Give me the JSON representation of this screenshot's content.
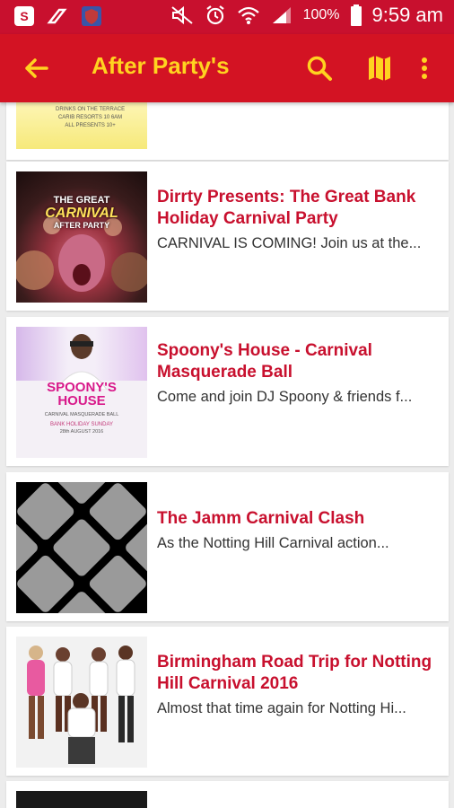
{
  "status_bar": {
    "battery": "100%",
    "time": "9:59 am"
  },
  "app_bar": {
    "title": "After Party's"
  },
  "cards": [
    {
      "title": "Dirrty Presents: The Great Bank Holiday Carnival Party",
      "description": "CARNIVAL IS COMING! Join us at the..."
    },
    {
      "title": "Spoony's House - Carnival Masquerade Ball",
      "description": "Come and join DJ Spoony & friends f..."
    },
    {
      "title": "The Jamm Carnival Clash",
      "description": "As the Notting Hill Carnival action..."
    },
    {
      "title": "Birmingham Road Trip for Notting Hill Carnival 2016",
      "description": "Almost that time again for Notting Hi..."
    }
  ],
  "thumb_texts": {
    "partial_top": [
      "DRINKS ON THE TERRACE",
      "CARIB RESORTS 10 6AM",
      "ALL PRESENTS 10+"
    ],
    "dirrty": [
      "THE GREAT",
      "CARNIVAL",
      "AFTER PARTY"
    ],
    "spoony": [
      "SPOONY'S",
      "HOUSE",
      "CARNIVAL MASQUERADE BALL",
      "BANK HOLIDAY SUNDAY",
      "28th AUGUST 2016"
    ]
  },
  "colors": {
    "primary": "#d31323",
    "accent": "#ffd320",
    "title_text": "#c8102e"
  },
  "icons": [
    "back-arrow-icon",
    "search-icon",
    "map-icon",
    "more-vert-icon"
  ]
}
